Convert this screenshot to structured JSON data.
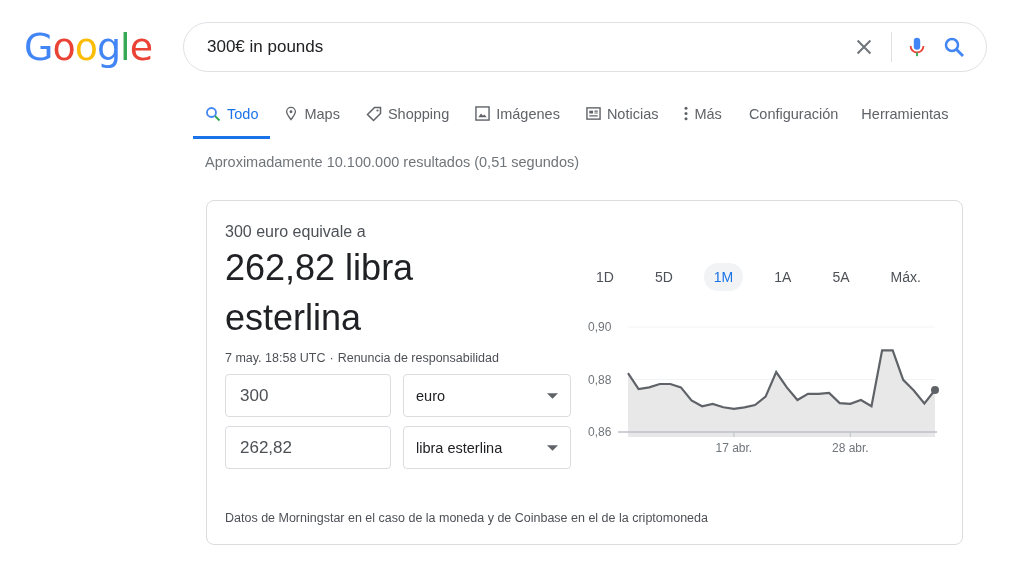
{
  "logo": "Google",
  "search": {
    "value": "300€ in pounds"
  },
  "tabs": [
    {
      "label": "Todo",
      "kind": "search",
      "selected": true
    },
    {
      "label": "Maps",
      "kind": "pin",
      "selected": false
    },
    {
      "label": "Shopping",
      "kind": "tag",
      "selected": false
    },
    {
      "label": "Imágenes",
      "kind": "image",
      "selected": false
    },
    {
      "label": "Noticias",
      "kind": "news",
      "selected": false
    },
    {
      "label": "Más",
      "kind": "dots",
      "selected": false
    }
  ],
  "tools": [
    "Configuración",
    "Herramientas"
  ],
  "result_stats": "Aproximadamente 10.100.000 resultados (0,51 segundos)",
  "converter": {
    "heading": "300 euro equivale a",
    "result": "262,82 libra esterlina",
    "timestamp": "7 may. 18:58 UTC",
    "separator": "·",
    "disclaimer": "Renuncia de responsabilidad",
    "rows": [
      {
        "amount": "300",
        "currency": "euro"
      },
      {
        "amount": "262,82",
        "currency": "libra esterlina"
      }
    ],
    "ranges": [
      {
        "label": "1D",
        "selected": false
      },
      {
        "label": "5D",
        "selected": false
      },
      {
        "label": "1M",
        "selected": true
      },
      {
        "label": "1A",
        "selected": false
      },
      {
        "label": "5A",
        "selected": false
      },
      {
        "label": "Máx.",
        "selected": false
      }
    ],
    "chart_data": {
      "type": "area",
      "categories": [
        null,
        null,
        null,
        null,
        null,
        null,
        null,
        null,
        null,
        null,
        "17 abr.",
        null,
        null,
        null,
        null,
        null,
        null,
        null,
        null,
        null,
        null,
        "28 abr.",
        null,
        null,
        null,
        null,
        null,
        null,
        null,
        null
      ],
      "series": [
        {
          "color": "#5f6368",
          "values": [
            0.8824,
            0.8764,
            0.877,
            0.8783,
            0.8783,
            0.877,
            0.872,
            0.8698,
            0.8707,
            0.8694,
            0.8688,
            0.8694,
            0.8703,
            0.8735,
            0.8828,
            0.877,
            0.8722,
            0.8745,
            0.8745,
            0.8749,
            0.871,
            0.8707,
            0.8722,
            0.8698,
            0.8911,
            0.8911,
            0.8799,
            0.8758,
            0.8709,
            0.876
          ]
        }
      ],
      "ylim": [
        0.86,
        0.9
      ],
      "yticks": [
        {
          "value": 0.86,
          "label": "0,86"
        },
        {
          "value": 0.88,
          "label": "0,88"
        },
        {
          "value": 0.9,
          "label": "0,90"
        }
      ]
    },
    "source": "Datos de Morningstar en el caso de la moneda y de Coinbase en el de la criptomoneda"
  }
}
